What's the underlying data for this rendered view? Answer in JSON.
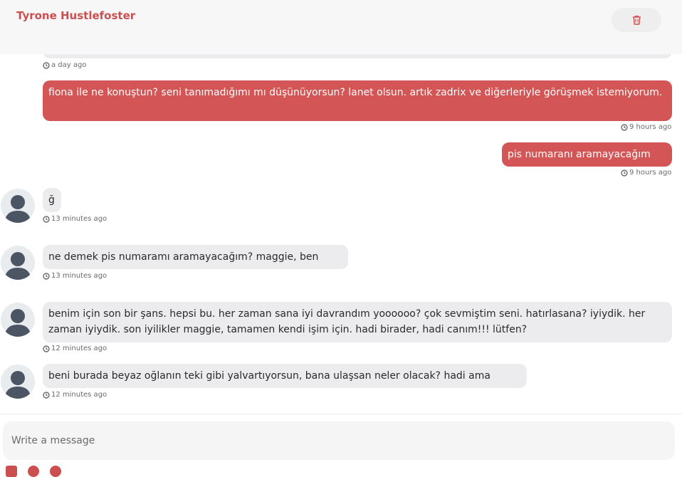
{
  "header": {
    "contact_name": "Tyrone Hustlefoster",
    "delete_icon": "trash-icon"
  },
  "messages": [
    {
      "direction": "incoming",
      "text": "",
      "time": "a day ago"
    },
    {
      "direction": "outgoing",
      "text": "fiona ile ne konuştun? seni tanımadığımı mı düşünüyorsun? lanet olsun. artık zadrix ve diğerleriyle görüşmek istemiyorum.",
      "time": "9 hours ago"
    },
    {
      "direction": "outgoing",
      "text": "pis numaranı aramayacağım",
      "time": "9 hours ago"
    },
    {
      "direction": "incoming",
      "text": "ğ",
      "time": "13 minutes ago"
    },
    {
      "direction": "incoming",
      "text": "ne demek pis numaramı aramayacağım? maggie, ben",
      "time": "13 minutes ago"
    },
    {
      "direction": "incoming",
      "text": "benim için son bir şans. hepsi bu. her zaman sana iyi davrandım yoooooo? çok sevmiştim seni. hatırlasana? iyiydik. her zaman iyiydik. son iyilikler maggie, tamamen kendi işim için. hadi birader, hadi canım!!! lütfen?",
      "time": "12 minutes ago"
    },
    {
      "direction": "incoming",
      "text": "beni burada beyaz oğlanın teki gibi yalvartıyorsun, bana ulaşsan neler olacak? hadi ama",
      "time": "12 minutes ago"
    }
  ],
  "composer": {
    "placeholder": "Write a message"
  },
  "colors": {
    "accent": "#cc4f4f",
    "outgoing_bubble": "#d35555",
    "incoming_bubble": "#ececef"
  }
}
